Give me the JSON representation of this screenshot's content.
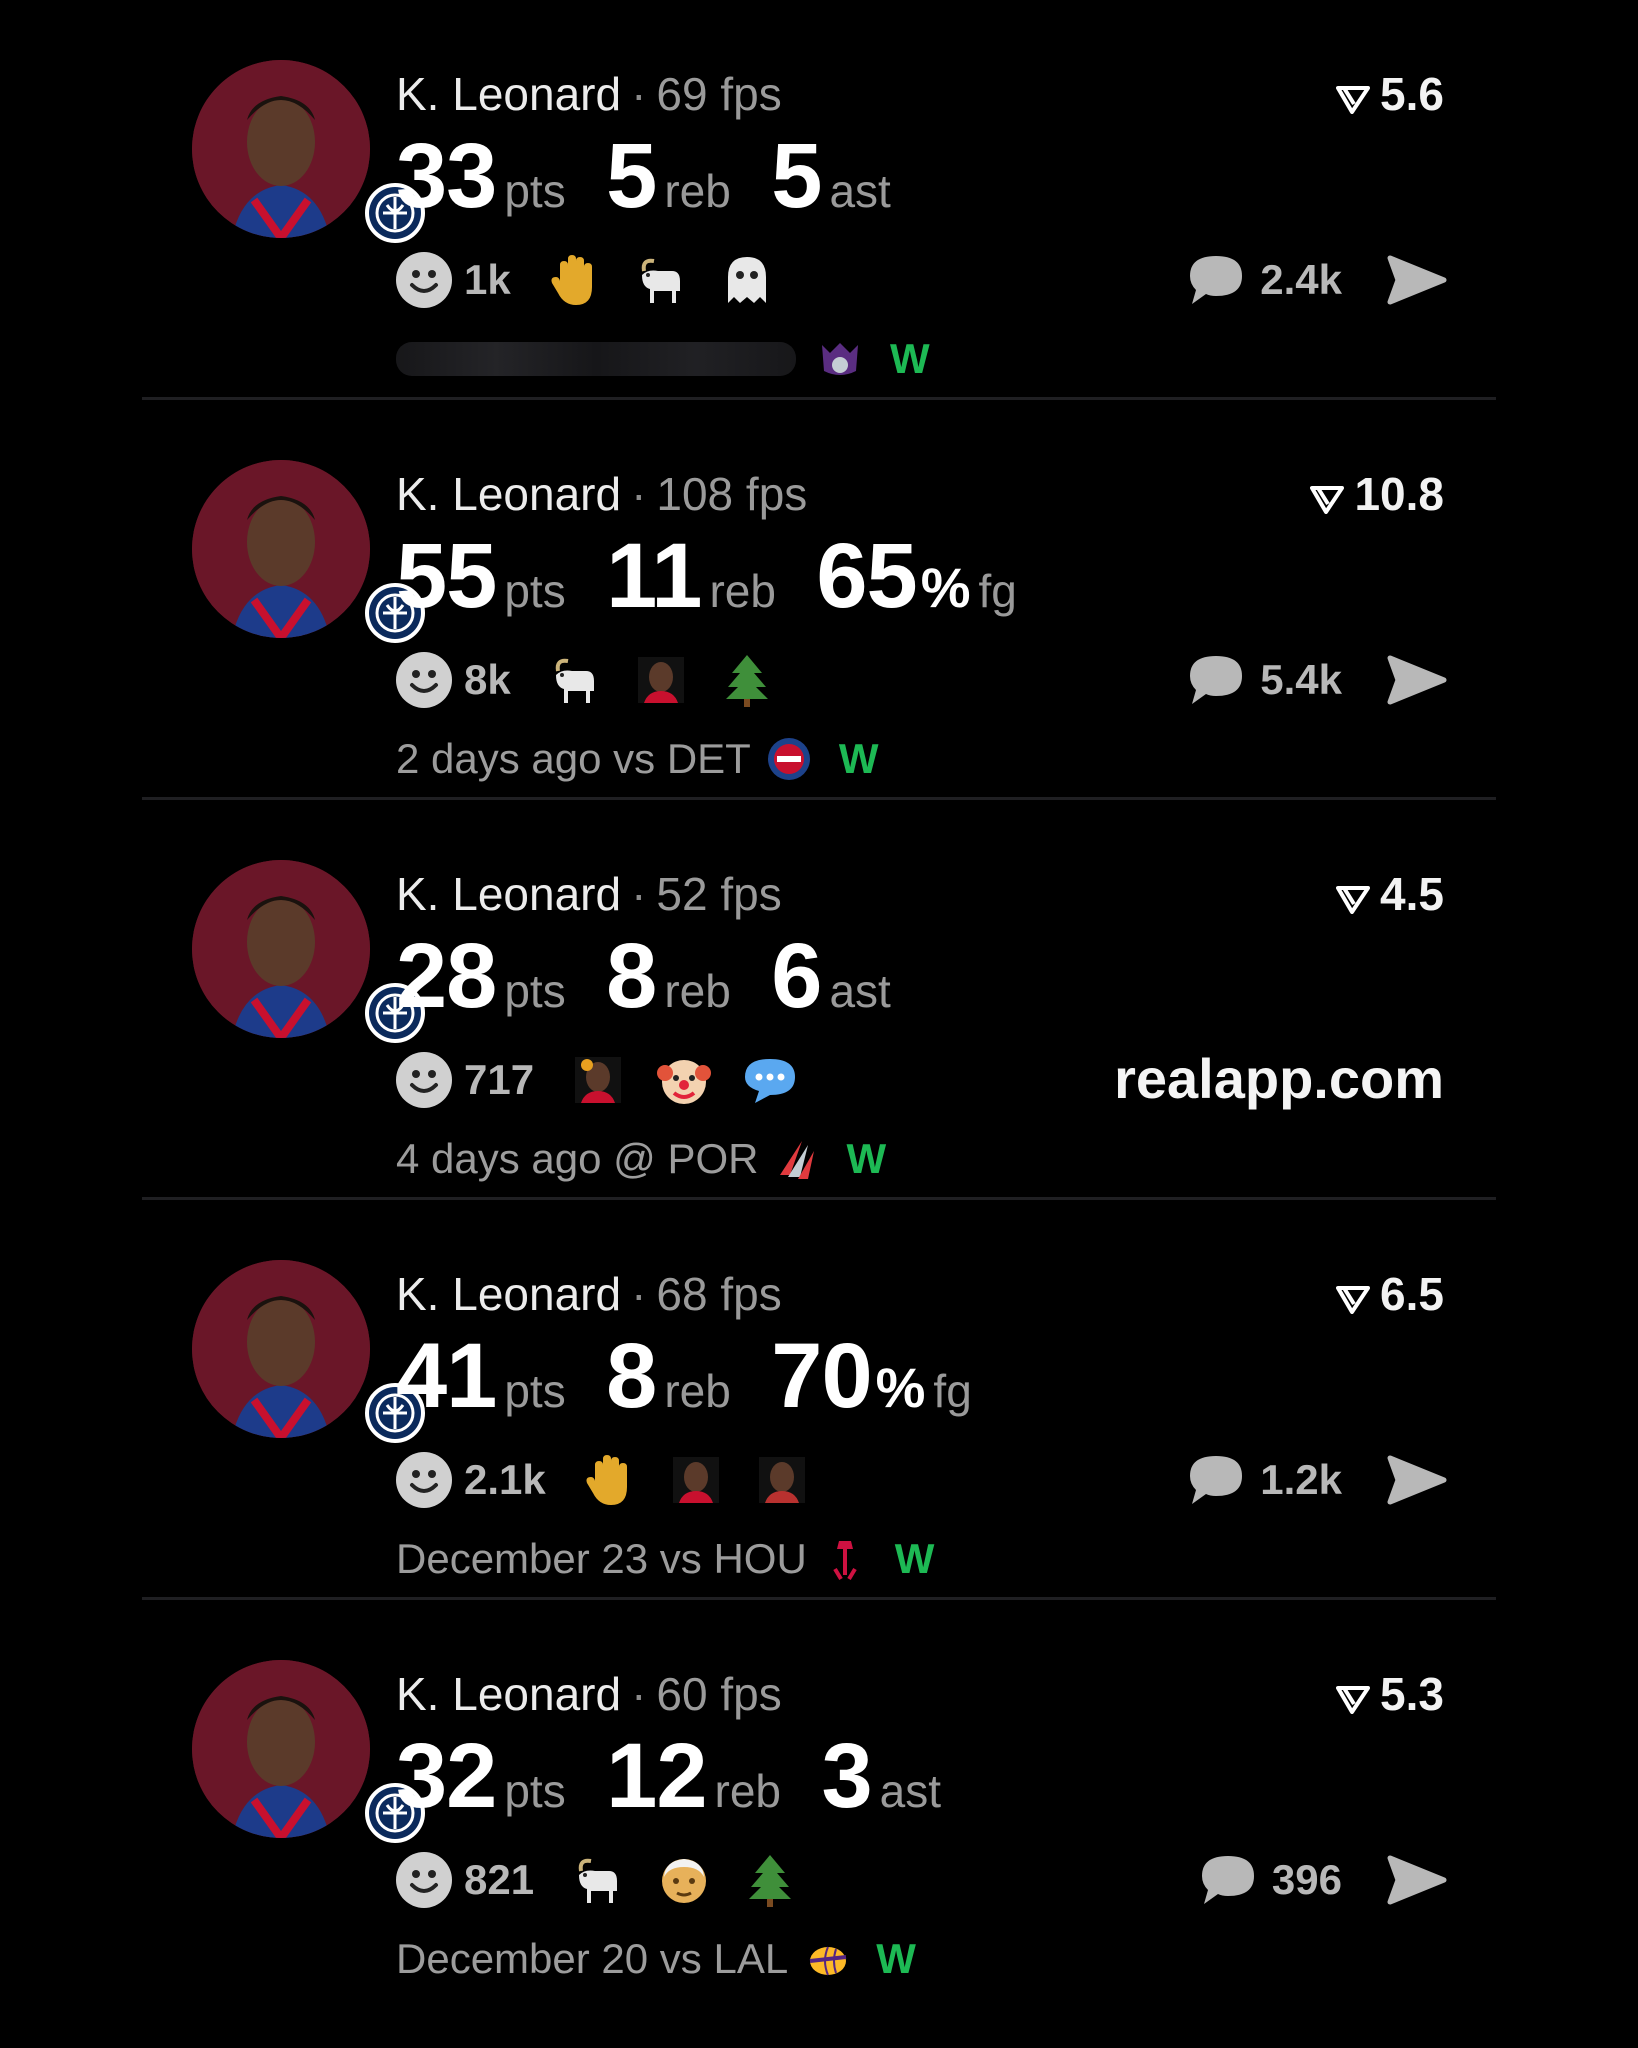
{
  "colors": {
    "win": "#1db954",
    "avatar_bg": "#6a1628",
    "muted": "#9a9a9a"
  },
  "cards": [
    {
      "player": "K. Leonard",
      "fps": "69 fps",
      "rating": "5.6",
      "stats": [
        {
          "value": "33",
          "pct": "",
          "unit": "pts"
        },
        {
          "value": "5",
          "pct": "",
          "unit": "reb"
        },
        {
          "value": "5",
          "pct": "",
          "unit": "ast"
        }
      ],
      "reaction_count": "1k",
      "emojis": [
        "raised-hand-icon",
        "goat-icon",
        "ghost-icon"
      ],
      "comment_count": "2.4k",
      "when": "",
      "team_logo": "kings-logo-icon",
      "result": "W"
    },
    {
      "player": "K. Leonard",
      "fps": "108 fps",
      "rating": "10.8",
      "stats": [
        {
          "value": "55",
          "pct": "",
          "unit": "pts"
        },
        {
          "value": "11",
          "pct": "",
          "unit": "reb"
        },
        {
          "value": "65",
          "pct": "%",
          "unit": "fg"
        }
      ],
      "reaction_count": "8k",
      "emojis": [
        "goat-icon",
        "player-face-icon",
        "evergreen-tree-icon"
      ],
      "comment_count": "5.4k",
      "when": "2 days ago vs DET",
      "team_logo": "pistons-logo-icon",
      "result": "W"
    },
    {
      "player": "K. Leonard",
      "fps": "52 fps",
      "rating": "4.5",
      "stats": [
        {
          "value": "28",
          "pct": "",
          "unit": "pts"
        },
        {
          "value": "8",
          "pct": "",
          "unit": "reb"
        },
        {
          "value": "6",
          "pct": "",
          "unit": "ast"
        }
      ],
      "reaction_count": "717",
      "emojis": [
        "player-face-icon",
        "clown-face-icon",
        "speech-bubble-icon"
      ],
      "comment_count": "",
      "watermark": "realapp.com",
      "when": "4 days ago @ POR",
      "team_logo": "blazers-logo-icon",
      "result": "W"
    },
    {
      "player": "K. Leonard",
      "fps": "68 fps",
      "rating": "6.5",
      "stats": [
        {
          "value": "41",
          "pct": "",
          "unit": "pts"
        },
        {
          "value": "8",
          "pct": "",
          "unit": "reb"
        },
        {
          "value": "70",
          "pct": "%",
          "unit": "fg"
        }
      ],
      "reaction_count": "2.1k",
      "emojis": [
        "raised-hand-icon",
        "player-face-icon",
        "player-face-icon"
      ],
      "comment_count": "1.2k",
      "when": "December 23 vs HOU",
      "team_logo": "rockets-logo-icon",
      "result": "W"
    },
    {
      "player": "K. Leonard",
      "fps": "60 fps",
      "rating": "5.3",
      "stats": [
        {
          "value": "32",
          "pct": "",
          "unit": "pts"
        },
        {
          "value": "12",
          "pct": "",
          "unit": "reb"
        },
        {
          "value": "3",
          "pct": "",
          "unit": "ast"
        }
      ],
      "reaction_count": "821",
      "emojis": [
        "goat-icon",
        "old-man-icon",
        "evergreen-tree-icon"
      ],
      "comment_count": "396",
      "when": "December 20 vs LAL",
      "team_logo": "lakers-logo-icon",
      "result": "W"
    }
  ]
}
